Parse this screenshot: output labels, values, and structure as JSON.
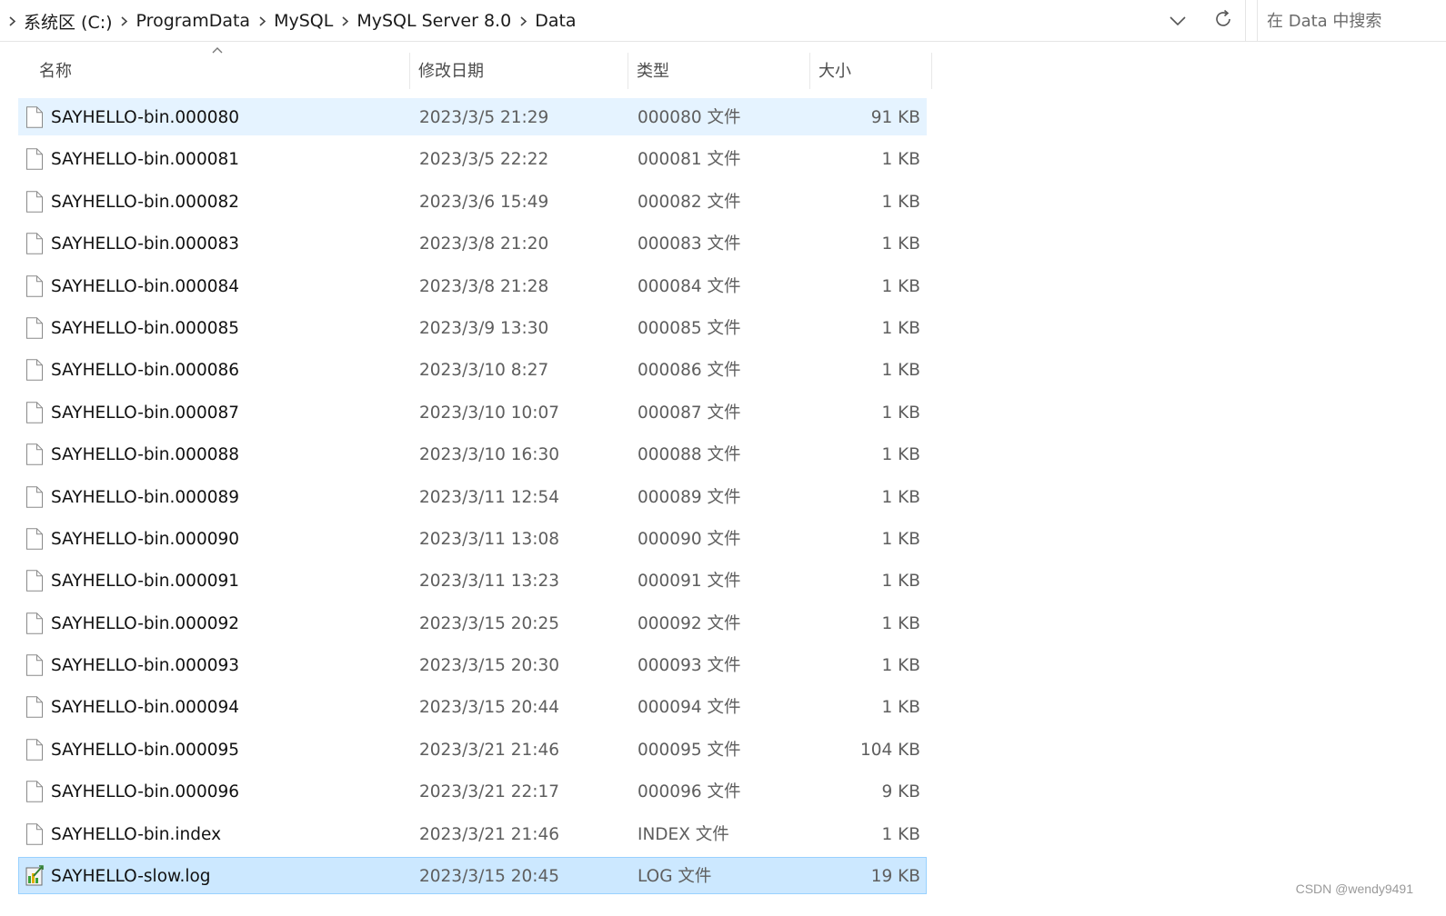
{
  "breadcrumb": [
    "系统区 (C:)",
    "ProgramData",
    "MySQL",
    "MySQL Server 8.0",
    "Data"
  ],
  "search": {
    "placeholder": "在 Data 中搜索"
  },
  "columns": {
    "name": "名称",
    "date": "修改日期",
    "type": "类型",
    "size": "大小"
  },
  "files": [
    {
      "name": "SAYHELLO-bin.000080",
      "date": "2023/3/5 21:29",
      "type": "000080 文件",
      "size": "91 KB",
      "icon": "file-icon",
      "state": "hover"
    },
    {
      "name": "SAYHELLO-bin.000081",
      "date": "2023/3/5 22:22",
      "type": "000081 文件",
      "size": "1 KB",
      "icon": "file-icon"
    },
    {
      "name": "SAYHELLO-bin.000082",
      "date": "2023/3/6 15:49",
      "type": "000082 文件",
      "size": "1 KB",
      "icon": "file-icon"
    },
    {
      "name": "SAYHELLO-bin.000083",
      "date": "2023/3/8 21:20",
      "type": "000083 文件",
      "size": "1 KB",
      "icon": "file-icon"
    },
    {
      "name": "SAYHELLO-bin.000084",
      "date": "2023/3/8 21:28",
      "type": "000084 文件",
      "size": "1 KB",
      "icon": "file-icon"
    },
    {
      "name": "SAYHELLO-bin.000085",
      "date": "2023/3/9 13:30",
      "type": "000085 文件",
      "size": "1 KB",
      "icon": "file-icon"
    },
    {
      "name": "SAYHELLO-bin.000086",
      "date": "2023/3/10 8:27",
      "type": "000086 文件",
      "size": "1 KB",
      "icon": "file-icon"
    },
    {
      "name": "SAYHELLO-bin.000087",
      "date": "2023/3/10 10:07",
      "type": "000087 文件",
      "size": "1 KB",
      "icon": "file-icon"
    },
    {
      "name": "SAYHELLO-bin.000088",
      "date": "2023/3/10 16:30",
      "type": "000088 文件",
      "size": "1 KB",
      "icon": "file-icon"
    },
    {
      "name": "SAYHELLO-bin.000089",
      "date": "2023/3/11 12:54",
      "type": "000089 文件",
      "size": "1 KB",
      "icon": "file-icon"
    },
    {
      "name": "SAYHELLO-bin.000090",
      "date": "2023/3/11 13:08",
      "type": "000090 文件",
      "size": "1 KB",
      "icon": "file-icon"
    },
    {
      "name": "SAYHELLO-bin.000091",
      "date": "2023/3/11 13:23",
      "type": "000091 文件",
      "size": "1 KB",
      "icon": "file-icon"
    },
    {
      "name": "SAYHELLO-bin.000092",
      "date": "2023/3/15 20:25",
      "type": "000092 文件",
      "size": "1 KB",
      "icon": "file-icon"
    },
    {
      "name": "SAYHELLO-bin.000093",
      "date": "2023/3/15 20:30",
      "type": "000093 文件",
      "size": "1 KB",
      "icon": "file-icon"
    },
    {
      "name": "SAYHELLO-bin.000094",
      "date": "2023/3/15 20:44",
      "type": "000094 文件",
      "size": "1 KB",
      "icon": "file-icon"
    },
    {
      "name": "SAYHELLO-bin.000095",
      "date": "2023/3/21 21:46",
      "type": "000095 文件",
      "size": "104 KB",
      "icon": "file-icon"
    },
    {
      "name": "SAYHELLO-bin.000096",
      "date": "2023/3/21 22:17",
      "type": "000096 文件",
      "size": "9 KB",
      "icon": "file-icon"
    },
    {
      "name": "SAYHELLO-bin.index",
      "date": "2023/3/21 21:46",
      "type": "INDEX 文件",
      "size": "1 KB",
      "icon": "file-icon"
    },
    {
      "name": "SAYHELLO-slow.log",
      "date": "2023/3/15 20:45",
      "type": "LOG 文件",
      "size": "19 KB",
      "icon": "log-file-icon",
      "state": "selected"
    }
  ],
  "watermark": "CSDN @wendy9491",
  "colors": {
    "hover": "#e5f3ff",
    "selected": "#cce8ff",
    "selected_border": "#99d1ff"
  }
}
